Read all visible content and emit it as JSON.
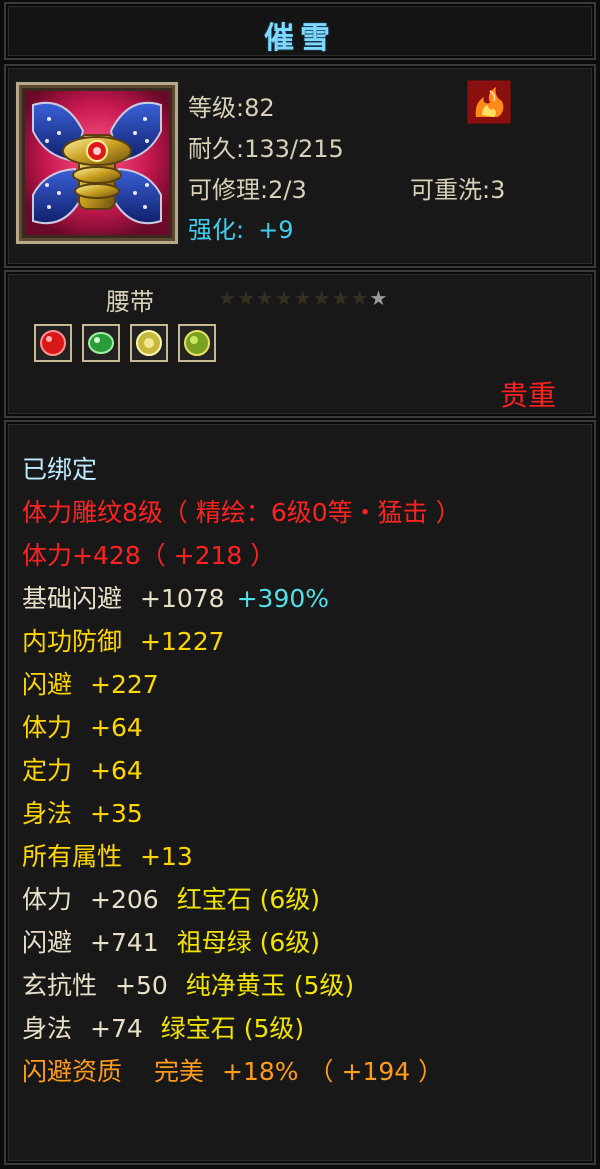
{
  "item": {
    "name": "催雪",
    "level_label": "等级:",
    "level": "82",
    "durability_label": "耐久:",
    "durability": "133/215",
    "repair_label": "可修理:",
    "repair": "2/3",
    "rewash_label": "可重洗:",
    "rewash": "3",
    "strength_label": "强化:",
    "strength": "+9",
    "type": "腰带",
    "stars_total": 9,
    "stars_lit": 1,
    "rarity": "贵重",
    "gem_slots": [
      {
        "icon": "red-gem-icon",
        "color": "#d81818"
      },
      {
        "icon": "green-gem-icon",
        "color": "#2a9a3a"
      },
      {
        "icon": "yellow-gem-icon",
        "color": "#c8b840"
      },
      {
        "icon": "jade-gem-icon",
        "color": "#7aa020"
      }
    ]
  },
  "attributes": {
    "bound": "已绑定",
    "engrave_line": "体力雕纹8级（ 精绘：6级0等・猛击 ）",
    "stamina_bonus_label": "体力",
    "stamina_bonus_value": "+428",
    "stamina_bonus_extra": "（ +218 ）",
    "base_dodge_label": "基础闪避",
    "base_dodge_value": "+1078",
    "base_dodge_pct": "+390%",
    "inner_def_label": "内功防御",
    "inner_def_value": "+1227",
    "extras": [
      {
        "label": "闪避",
        "value": "+227"
      },
      {
        "label": "体力",
        "value": "+64"
      },
      {
        "label": "定力",
        "value": "+64"
      },
      {
        "label": "身法",
        "value": "+35"
      },
      {
        "label": "所有属性",
        "value": "+13"
      }
    ],
    "gems": [
      {
        "label": "体力",
        "value": "+206",
        "gem": "红宝石 (6级)"
      },
      {
        "label": "闪避",
        "value": "+741",
        "gem": "祖母绿 (6级)"
      },
      {
        "label": "玄抗性",
        "value": "+50",
        "gem": "纯净黄玉 (5级)"
      },
      {
        "label": "身法",
        "value": "+74",
        "gem": "绿宝石 (5级)"
      }
    ],
    "aptitude_label": "闪避资质",
    "aptitude_grade": "完美",
    "aptitude_pct": "+18%",
    "aptitude_extra": "（ +194 ）"
  }
}
